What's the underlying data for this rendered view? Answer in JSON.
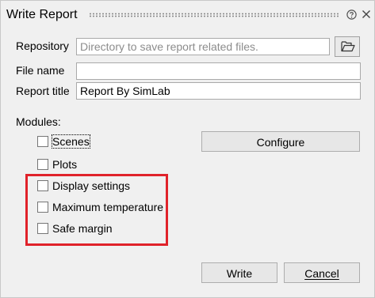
{
  "dialog": {
    "title": "Write Report"
  },
  "icons": {
    "help": "help-circle-icon",
    "close": "close-icon",
    "folder": "folder-open-icon"
  },
  "fields": {
    "repository_label": "Repository",
    "repository_placeholder": "Directory to save report related files.",
    "repository_value": "",
    "filename_label": "File name",
    "filename_value": "",
    "report_title_label": "Report title",
    "report_title_value": "Report By SimLab"
  },
  "modules": {
    "label": "Modules:",
    "items": [
      {
        "label": "Scenes",
        "checked": false
      },
      {
        "label": "Plots",
        "checked": false
      },
      {
        "label": "Display settings",
        "checked": false
      },
      {
        "label": "Maximum temperature",
        "checked": false
      },
      {
        "label": "Safe margin",
        "checked": false
      }
    ],
    "configure_label": "Configure"
  },
  "footer": {
    "write_label": "Write",
    "cancel_label": "Cancel"
  },
  "colors": {
    "highlight": "#e0222a",
    "background": "#f0f0f0"
  }
}
